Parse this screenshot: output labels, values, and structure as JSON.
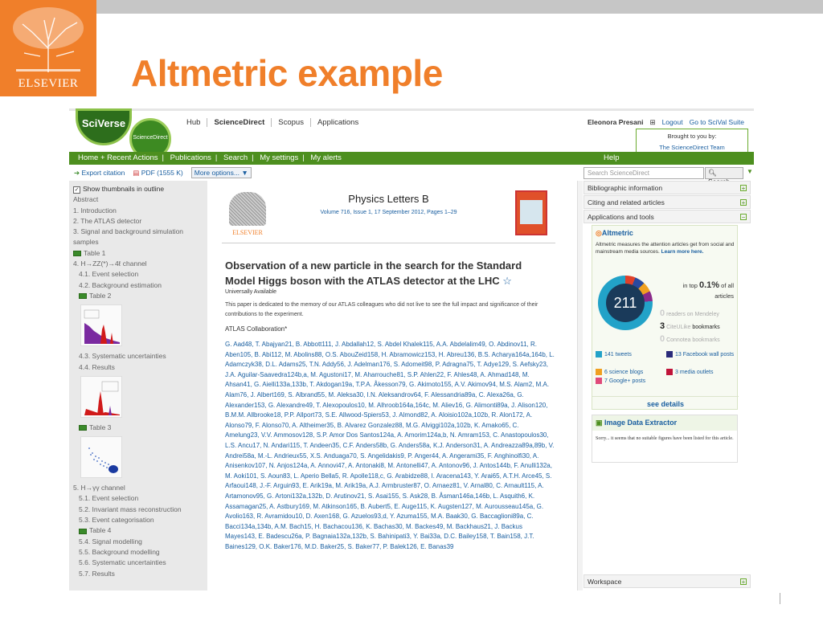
{
  "slide": {
    "title": "Altmetric example",
    "logo_text": "ELSEVIER"
  },
  "header": {
    "logo_sciverse": "SciVerse",
    "logo_sciencedirect": "ScienceDirect",
    "nav": [
      "Hub",
      "ScienceDirect",
      "Scopus",
      "Applications"
    ],
    "user_name": "Eleonora Presani",
    "logout": "Logout",
    "goto": "Go to SciVal Suite",
    "brought_by": "Brought to you by:",
    "brought_team": "The ScienceDirect Team"
  },
  "greenbar": {
    "items": [
      "Home + Recent Actions",
      "Publications",
      "Search",
      "My settings",
      "My alerts"
    ],
    "help": "Help"
  },
  "toolbar": {
    "export": "Export citation",
    "pdf": "PDF (1555 K)",
    "more": "More options..."
  },
  "search": {
    "placeholder": "Search ScienceDirect",
    "button": "Search"
  },
  "outline": {
    "show_thumbnails": "Show thumbnails in outline",
    "rows": {
      "abstract": "Abstract",
      "intro": "1. Introduction",
      "atlas": "2. The ATLAS detector",
      "signal": "3. Signal and background simulation",
      "samples": "samples",
      "table1": "Table 1",
      "ch4": "4. H→ZZ(*)→4ℓ channel",
      "s41": "4.1. Event selection",
      "s42": "4.2. Background estimation",
      "table2": "Table 2",
      "s43": "4.3. Systematic uncertainties",
      "s44": "4.4. Results",
      "table3": "Table 3",
      "ch5": "5. H→γγ channel",
      "s51": "5.1. Event selection",
      "s52": "5.2. Invariant mass reconstruction",
      "s53": "5.3. Event categorisation",
      "table4": "Table 4",
      "s54": "5.4. Signal modelling",
      "s55": "5.5. Background modelling",
      "s56": "5.6. Systematic uncertainties",
      "s57": "5.7. Results"
    }
  },
  "article": {
    "journal": "Physics Letters B",
    "volume": "Volume 716, Issue 1, 17 September 2012, Pages 1–29",
    "publisher_logo": "ELSEVIER",
    "title": "Observation of a new particle in the search for the Standard Model Higgs boson with the ATLAS detector at the LHC",
    "star": "☆",
    "availability": "Universally Available",
    "dedication": "This paper is dedicated to the memory of our ATLAS colleagues who did not live to see the full impact and significance of their contributions to the experiment.",
    "collaboration": "ATLAS Collaboration*",
    "authors": "G. Aad48, T. Abajyan21, B. Abbott111, J. Abdallah12, S. Abdel Khalek115, A.A. Abdelalim49, O. Abdinov11, R. Aben105, B. Abi112, M. Abolins88, O.S. AbouZeid158, H. Abramowicz153, H. Abreu136, B.S. Acharya164a,164b, L. Adamczyk38, D.L. Adams25, T.N. Addy56, J. Adelman176, S. Adomeit98, P. Adragna75, T. Adye129, S. Aefsky23, J.A. Aguilar-Saavedra124b,a, M. Agustoni17, M. Aharrouche81, S.P. Ahlen22, F. Ahles48, A. Ahmad148, M. Ahsan41, G. Aielli133a,133b, T. Akdogan19a, T.P.A. Åkesson79, G. Akimoto155, A.V. Akimov94, M.S. Alam2, M.A. Alam76, J. Albert169, S. Albrand55, M. Aleksa30, I.N. Aleksandrov64, F. Alessandria89a, C. Alexa26a, G. Alexander153, G. Alexandre49, T. Alexopoulos10, M. Alhroob164a,164c, M. Aliev16, G. Alimonti89a, J. Alison120, B.M.M. Allbrooke18, P.P. Allport73, S.E. Allwood-Spiers53, J. Almond82, A. Aloisio102a,102b, R. Alon172, A. Alonso79, F. Alonso70, A. Altheimer35, B. Alvarez Gonzalez88, M.G. Alviggi102a,102b, K. Amako65, C. Amelung23, V.V. Ammosov128, S.P. Amor Dos Santos124a, A. Amorim124a,b, N. Amram153, C. Anastopoulos30, L.S. Ancu17, N. Andari115, T. Andeen35, C.F. Anders58b, G. Anders58a, K.J. Anderson31, A. Andreazza89a,89b, V. Andrei58a, M.-L. Andrieux55, X.S. Anduaga70, S. Angelidakis9, P. Anger44, A. Angerami35, F. Anghinolfi30, A. Anisenkov107, N. Anjos124a, A. Annovi47, A. Antonaki8, M. Antonelli47, A. Antonov96, J. Antos144b, F. Anulli132a, M. Aoki101, S. Aoun83, L. Aperio Bella5, R. Apolle118,c, G. Arabidze88, I. Aracena143, Y. Arai65, A.T.H. Arce45, S. Arfaoui148, J.-F. Arguin93, E. Arik19a, M. Arik19a, A.J. Armbruster87, O. Arnaez81, V. Arnal80, C. Arnault115, A. Artamonov95, G. Artoni132a,132b, D. Arutinov21, S. Asai155, S. Ask28, B. Åsman146a,146b, L. Asquith6, K. Assamagan25, A. Astbury169, M. Atkinson165, B. Aubert5, E. Auge115, K. Augsten127, M. Aurousseau145a, G. Avolio163, R. Avramidou10, D. Axen168, G. Azuelos93,d, Y. Azuma155, M.A. Baak30, G. Baccaglioni89a, C. Bacci134a,134b, A.M. Bach15, H. Bachacou136, K. Bachas30, M. Backes49, M. Backhaus21, J. Backus Mayes143, E. Badescu26a, P. Bagnaia132a,132b, S. Bahinipati3, Y. Bai33a, D.C. Bailey158, T. Bain158, J.T. Baines129, O.K. Baker176, M.D. Baker25, S. Baker77, P. Balek126, E. Banas39"
  },
  "sidebar": {
    "bibliographic": "Bibliographic information",
    "citing": "Citing and related articles",
    "applications": "Applications and tools",
    "workspace": "Workspace"
  },
  "altmetric": {
    "brand": "Altmetric",
    "description": "Altmetric measures the attention articles get from social and mainstream media sources.",
    "learn_more": "Learn more here.",
    "score": "211",
    "in_top": "in top",
    "percent": "0.1%",
    "of_all": "of all",
    "articles": "articles",
    "mendeley_count": "0",
    "mendeley": "readers on Mendeley",
    "citeulike_count": "3",
    "citeulike": "CiteULike",
    "bookmarks": "bookmarks",
    "connotea_count": "0",
    "connotea": "Connotea bookmarks",
    "tweets": "141 tweets",
    "facebook": "13 Facebook wall posts",
    "blogs": "6 science blogs",
    "media": "3 media outlets",
    "google": "7 Google+ posts",
    "see_details": "see details",
    "colors": {
      "tweets": "#22a2c8",
      "facebook": "#2a2a7a",
      "blogs": "#f0a020",
      "media": "#c0143a",
      "google": "#e04a7a"
    }
  },
  "image_extractor": {
    "title": "Image Data Extractor",
    "message": "Sorry... it seems that no suitable figures have been listed for this article."
  }
}
